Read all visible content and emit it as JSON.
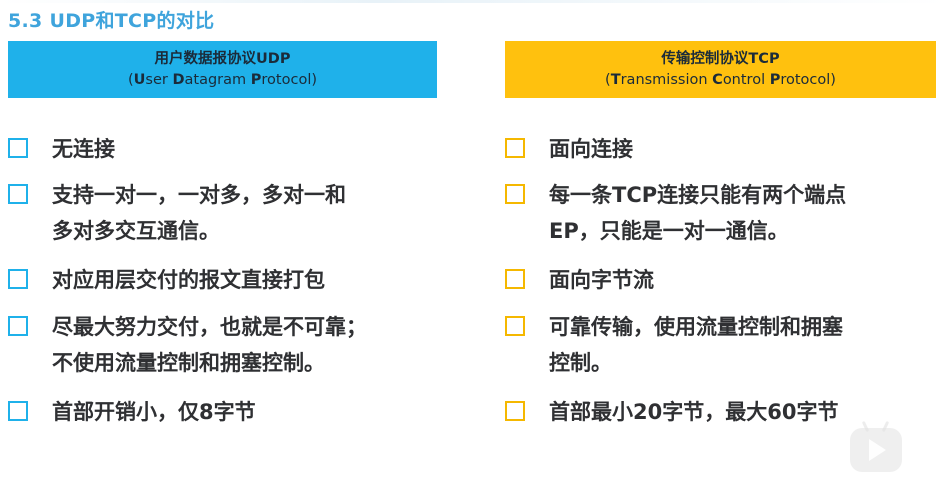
{
  "title": "5.3 UDP和TCP的对比",
  "udp": {
    "header_line1": "用户数据报协议UDP",
    "header_line2": {
      "open": "(",
      "U": "U",
      "ser": "ser ",
      "D": "D",
      "atagram": "atagram ",
      "P": "P",
      "rotocol": "rotocol)"
    },
    "items": [
      [
        "无连接"
      ],
      [
        "支持一对一，一对多，多对一和",
        "多对多交互通信。"
      ],
      [
        "对应用层交付的报文直接打包"
      ],
      [
        "尽最大努力交付，也就是不可靠；",
        "不使用流量控制和拥塞控制。"
      ],
      [
        "首部开销小，仅8字节"
      ]
    ]
  },
  "tcp": {
    "header_line1": "传输控制协议TCP",
    "header_line2": {
      "open": "(",
      "T": "T",
      "ransmission": "ransmission ",
      "C": "C",
      "ontrol": "ontrol ",
      "P": "P",
      "rotocol": "rotocol)"
    },
    "items": [
      [
        "面向连接"
      ],
      [
        "每一条TCP连接只能有两个端点",
        "EP，只能是一对一通信。"
      ],
      [
        "面向字节流"
      ],
      [
        "可靠传输，使用流量控制和拥塞",
        "控制。"
      ],
      [
        "首部最小20字节，最大60字节"
      ]
    ]
  },
  "colors": {
    "title": "#3fa4dc",
    "udp_accent": "#1fb1ea",
    "tcp_accent": "#ffc10e",
    "text": "#2f3033"
  },
  "icons": {
    "checkbox": "checkbox-square-icon",
    "watermark": "video-play-icon"
  }
}
